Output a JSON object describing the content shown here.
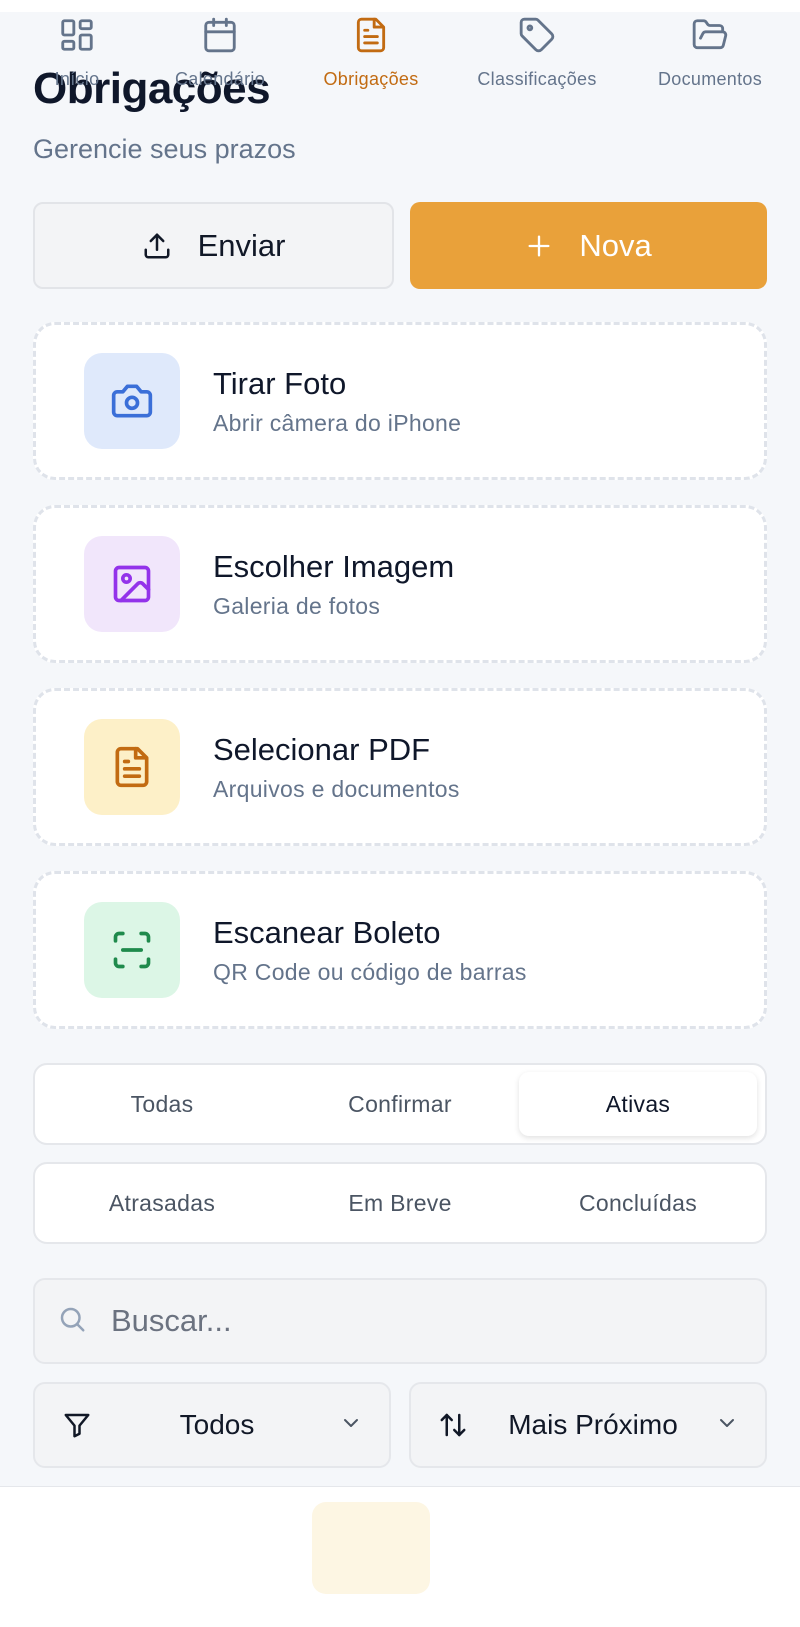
{
  "header": {
    "title": "Obrigações",
    "subtitle": "Gerencie seus prazos"
  },
  "actions": {
    "send_label": "Enviar",
    "new_label": "Nova"
  },
  "options": [
    {
      "title": "Tirar Foto",
      "subtitle": "Abrir câmera do iPhone",
      "icon": "camera-icon",
      "color": "#3b6fd8",
      "bg": "#dfe9fb"
    },
    {
      "title": "Escolher Imagem",
      "subtitle": "Galeria de fotos",
      "icon": "image-icon",
      "color": "#9333ea",
      "bg": "#f1e6fb"
    },
    {
      "title": "Selecionar PDF",
      "subtitle": "Arquivos e documentos",
      "icon": "document-icon",
      "color": "#c26b12",
      "bg": "#fdf0c8"
    },
    {
      "title": "Escanear Boleto",
      "subtitle": "QR Code ou código de barras",
      "icon": "scan-icon",
      "color": "#1f8a4c",
      "bg": "#dcf6e6"
    }
  ],
  "status_tabs": {
    "todas": "Todas",
    "confirmar": "Confirmar",
    "ativas": "Ativas",
    "active": "Ativas"
  },
  "time_tabs": {
    "atrasadas": "Atrasadas",
    "em_breve": "Em Breve",
    "concluidas": "Concluídas"
  },
  "search": {
    "placeholder": "Buscar..."
  },
  "filters": {
    "category": "Todos",
    "sort": "Mais Próximo"
  },
  "nav": {
    "items": [
      {
        "label": "Início",
        "icon": "grid-icon"
      },
      {
        "label": "Calendário",
        "icon": "calendar-icon"
      },
      {
        "label": "Obrigações",
        "icon": "document-icon"
      },
      {
        "label": "Classificações",
        "icon": "tag-icon"
      },
      {
        "label": "Documentos",
        "icon": "folder-icon"
      }
    ],
    "active": "Obrigações"
  },
  "colors": {
    "accent": "#e9a13a",
    "active_tab": "#c26b12",
    "background": "#f5f7fa"
  }
}
